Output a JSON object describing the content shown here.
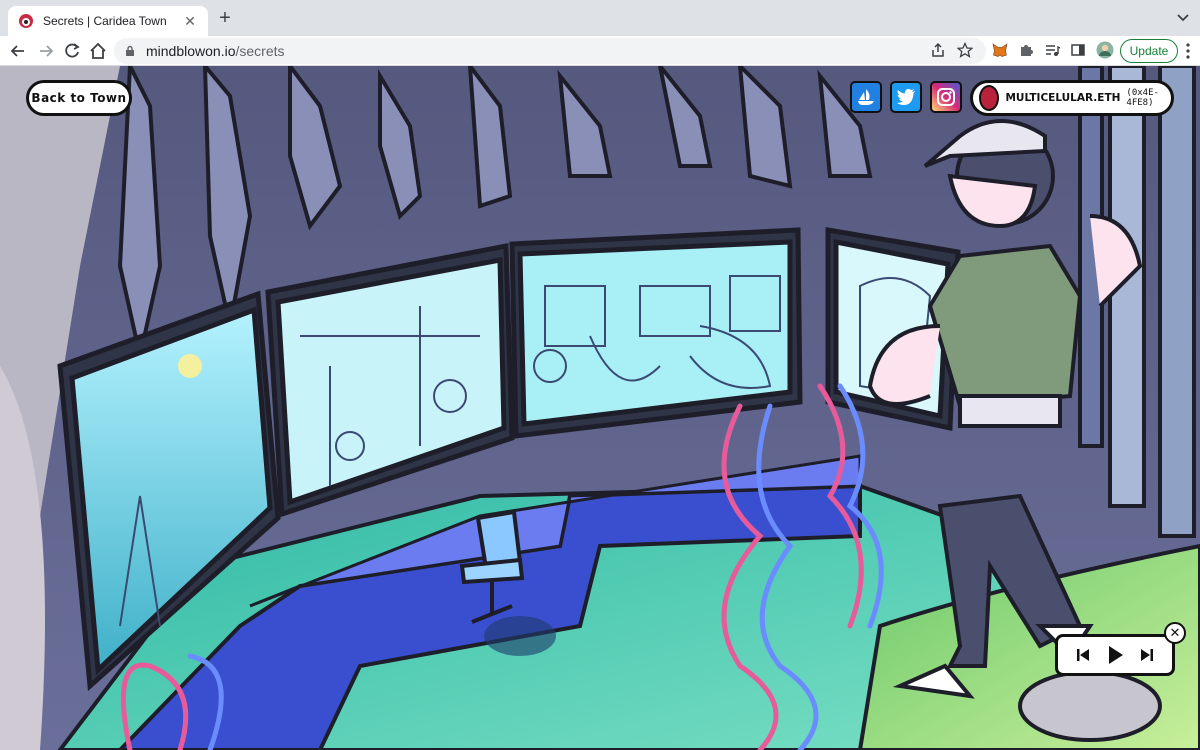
{
  "browser": {
    "tab": {
      "title": "Secrets | Caridea Town"
    },
    "address": {
      "host": "mindblowon.io",
      "path": "/secrets"
    },
    "update_label": "Update",
    "icons": [
      "back-arrow-icon",
      "forward-arrow-icon",
      "reload-icon",
      "home-icon",
      "lock-icon",
      "share-icon",
      "star-icon",
      "metamask-fox-icon",
      "extensions-puzzle-icon",
      "media-queue-icon",
      "side-panel-icon",
      "profile-avatar",
      "more-menu-icon",
      "tab-search-chevron-icon"
    ]
  },
  "page": {
    "back_label": "Back to Town",
    "social": [
      {
        "name": "opensea",
        "color": "#2081e2"
      },
      {
        "name": "twitter",
        "color": "#1d9bf0"
      },
      {
        "name": "instagram",
        "color": "#c13584"
      }
    ],
    "wallet": {
      "ens": "MULTICELULAR.ETH",
      "address": "(0x4E-4FE8)"
    },
    "player": {
      "state": "paused"
    }
  },
  "colors": {
    "chrome_bg": "#dee1e6",
    "update_green": "#188038",
    "cave": "#4a4f73",
    "screen_glow": "#8ef0e6",
    "floor_teal": "#3cb8a8",
    "desk_blue": "#2b3aa0",
    "cable_pink": "#e85b9a",
    "cable_blue": "#6b8cff"
  }
}
